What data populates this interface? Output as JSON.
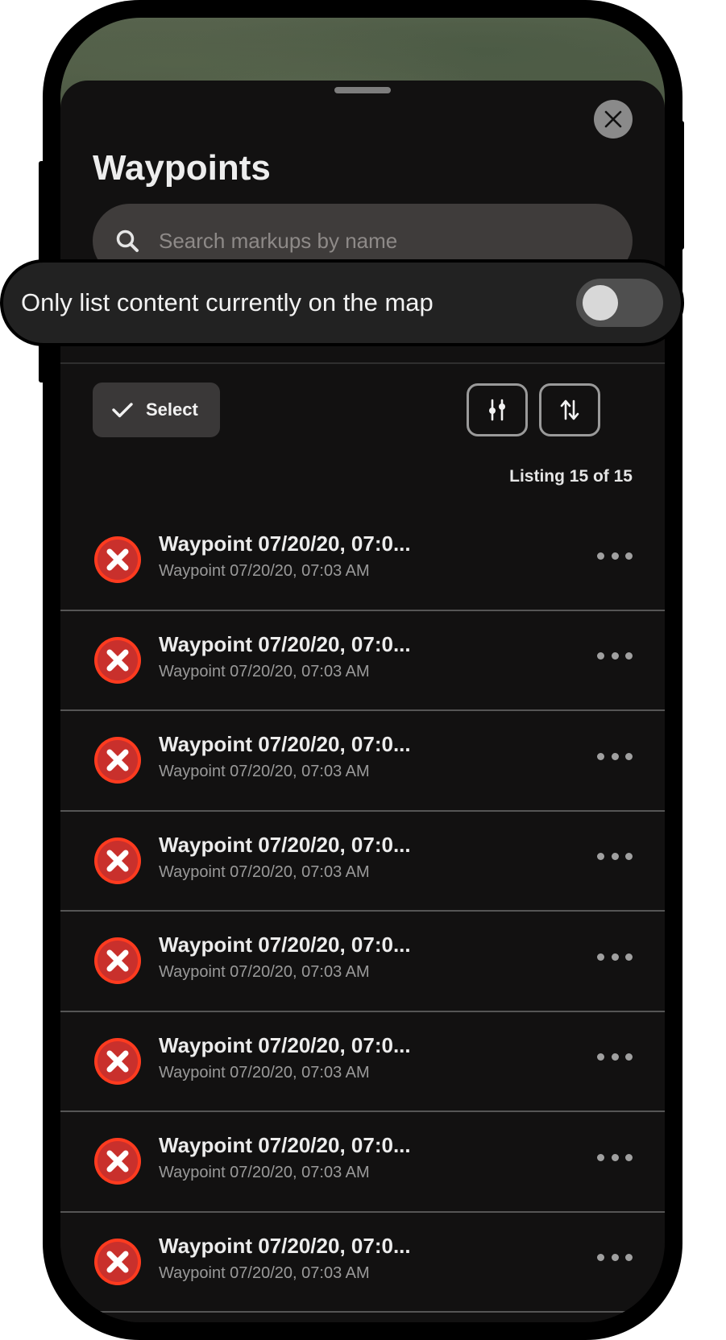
{
  "header": {
    "title": "Waypoints",
    "close_icon": "close-icon"
  },
  "search": {
    "placeholder": "Search markups by name",
    "value": ""
  },
  "filter_toggle": {
    "label": "Only list content currently on the map",
    "enabled": false
  },
  "toolbar": {
    "select_label": "Select",
    "filter_icon": "sliders-icon",
    "sort_icon": "sort-arrows-icon"
  },
  "listing": {
    "count_text": "Listing 15 of 15"
  },
  "items": [
    {
      "name": "Waypoint 07/20/20, 07:0...",
      "subtitle": "Waypoint 07/20/20, 07:03 AM"
    },
    {
      "name": "Waypoint 07/20/20, 07:0...",
      "subtitle": "Waypoint 07/20/20, 07:03 AM"
    },
    {
      "name": "Waypoint 07/20/20, 07:0...",
      "subtitle": "Waypoint 07/20/20, 07:03 AM"
    },
    {
      "name": "Waypoint 07/20/20, 07:0...",
      "subtitle": "Waypoint 07/20/20, 07:03 AM"
    },
    {
      "name": "Waypoint 07/20/20, 07:0...",
      "subtitle": "Waypoint 07/20/20, 07:03 AM"
    },
    {
      "name": "Waypoint 07/20/20, 07:0...",
      "subtitle": "Waypoint 07/20/20, 07:03 AM"
    },
    {
      "name": "Waypoint 07/20/20, 07:0...",
      "subtitle": "Waypoint 07/20/20, 07:03 AM"
    },
    {
      "name": "Waypoint 07/20/20, 07:0...",
      "subtitle": "Waypoint 07/20/20, 07:03 AM"
    }
  ],
  "colors": {
    "waypoint_icon_fill": "#c9302c",
    "waypoint_icon_ring": "#ff3b1f",
    "background": "#121111"
  }
}
